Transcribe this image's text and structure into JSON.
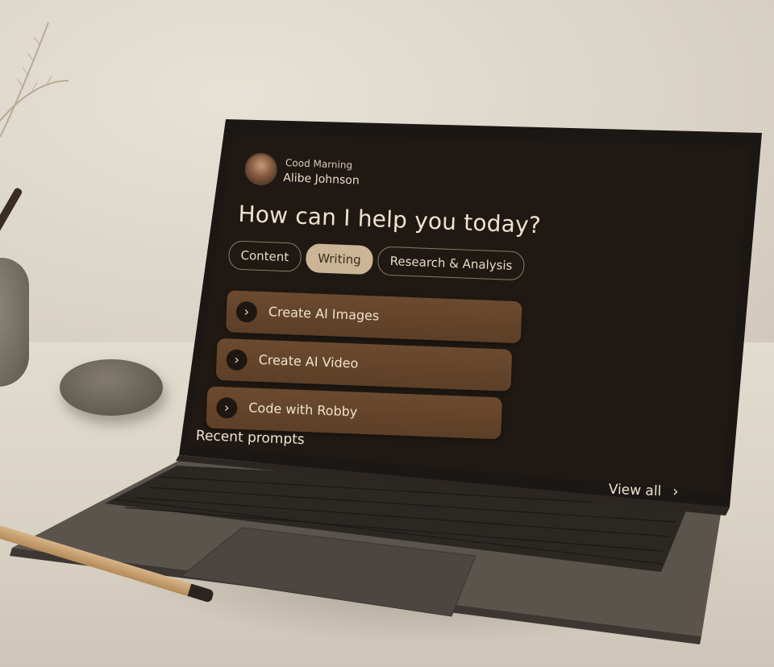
{
  "user": {
    "greeting": "Cood Marning",
    "name": "Alibe Johnson"
  },
  "headline": "How can I help you today?",
  "tabs": [
    {
      "label": "Content",
      "active": false
    },
    {
      "label": "Writing",
      "active": true
    },
    {
      "label": "Research & Analysis",
      "active": false
    }
  ],
  "actions": [
    {
      "label": "Create AI Images",
      "icon": "chevron-right-icon"
    },
    {
      "label": "Create AI Video",
      "icon": "chevron-right-icon"
    },
    {
      "label": "Code with Robby",
      "icon": "chevron-right-icon"
    }
  ],
  "recent": {
    "heading": "Recent prompts",
    "view_all": "View all"
  },
  "colors": {
    "screen_bg": "#1f1812",
    "card": "#5d3f27",
    "active_tab": "#cbb596",
    "text": "#efe3cf"
  }
}
